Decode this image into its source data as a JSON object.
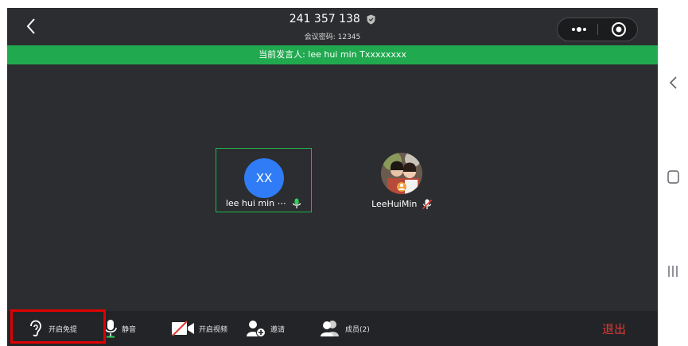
{
  "meeting": {
    "id": "241 357 138",
    "password_label": "会议密码: 12345"
  },
  "speaker_bar": {
    "text": "当前发言人: lee hui min Txxxxxxxx"
  },
  "participants": [
    {
      "initials": "XX",
      "name": "lee hui min ⋯",
      "avatar_color": "#2f7cf6",
      "mic": "on"
    },
    {
      "name": "LeeHuiMin",
      "mic": "muted"
    }
  ],
  "toolbar": {
    "handsfree_label": "开启免提",
    "mute_label": "静音",
    "video_label": "开启视频",
    "invite_label": "邀请",
    "members_label": "成员(2)",
    "exit_label": "退出"
  },
  "colors": {
    "speaker_bar": "#20a94f",
    "active_border": "#22b24c",
    "exit": "#e53935",
    "highlight": "#e00000"
  },
  "icons": [
    "back-arrow-icon",
    "shield-icon",
    "more-dots-icon",
    "record-target-icon",
    "mic-icon",
    "mic-muted-icon",
    "ear-icon",
    "video-off-icon",
    "add-person-icon",
    "members-icon",
    "nav-back-icon",
    "nav-home-icon",
    "nav-recents-icon"
  ]
}
